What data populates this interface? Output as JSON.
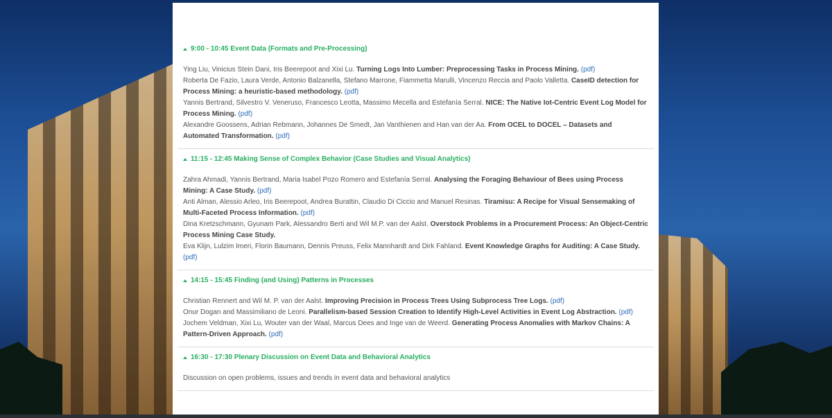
{
  "sessions": [
    {
      "title": "9:00 - 10:45 Event Data (Formats and Pre-Processing)",
      "papers": [
        {
          "authors": "Ying Liu, Vinicius Stein Dani, Iris Beerepoot and Xixi Lu.",
          "title": "Turning Logs Into Lumber: Preprocessing Tasks in Process Mining.",
          "link": "(pdf)"
        },
        {
          "authors": "Roberta De Fazio, Laura Verde, Antonio Balzanella, Stefano Marrone, Fiammetta Marulli, Vincenzo Reccia and Paolo Valletta.",
          "title": "CaseID detection for Process Mining: a heuristic-based methodology.",
          "link": "(pdf)"
        },
        {
          "authors": "Yannis Bertrand, Silvestro V. Veneruso, Francesco Leotta, Massimo Mecella and Estefanía Serral.",
          "title": "NICE: The Native Iot-Centric Event Log Model for Process Mining.",
          "link": "(pdf)"
        },
        {
          "authors": "Alexandre Goossens, Adrian Rebmann, Johannes De Smedt, Jan Vanthienen and Han van der Aa.",
          "title": "From OCEL to DOCEL – Datasets and Automated Transformation.",
          "link": "(pdf)"
        }
      ]
    },
    {
      "title": "11:15 - 12:45 Making Sense of Complex Behavior (Case Studies and Visual Analytics)",
      "papers": [
        {
          "authors": "Zahra Ahmadi, Yannis Bertrand, Maria Isabel Pozo Romero and Estefanía Serral.",
          "title": "Analysing the Foraging Behaviour of Bees using Process Mining: A Case Study.",
          "link": "(pdf)"
        },
        {
          "authors": "Anti Alman, Alessio Arleo, Iris Beerepoot, Andrea Burattin, Claudio Di Ciccio and Manuel Resinas.",
          "title": "Tiramisu: A Recipe for Visual Sensemaking of Multi-Faceted Process Information.",
          "link": "(pdf)"
        },
        {
          "authors": "Dina Kretzschmann, Gyunam Park, Alessandro Berti and Wil M.P. van der Aalst.",
          "title": "Overstock Problems in a Procurement Process: An Object-Centric Process Mining Case Study.",
          "link": ""
        },
        {
          "authors": "Eva Klijn, Lulzim Imeri, Florin Baumann, Dennis Preuss, Felix Mannhardt and Dirk Fahland.",
          "title": "Event Knowledge Graphs for Auditing: A Case Study.",
          "link": "(pdf)"
        }
      ]
    },
    {
      "title": "14:15 - 15:45 Finding (and Using) Patterns in Processes",
      "papers": [
        {
          "authors": "Christian Rennert and Wil M. P. van der Aalst.",
          "title": "Improving Precision in Process Trees Using Subprocess Tree Logs.",
          "link": "(pdf)"
        },
        {
          "authors": "Onur Dogan and Massimiliano de Leoni.",
          "title": "Parallelism-based Session Creation to Identify High-Level Activities in Event Log Abstraction.",
          "link": "(pdf)"
        },
        {
          "authors": "Jochem Veldman, Xixi Lu, Wouter van der Waal, Marcus Dees and Inge van de Weerd.",
          "title": " Generating Process Anomalies with Markov Chains: A Pattern-Driven Approach.",
          "link": "(pdf)"
        }
      ]
    },
    {
      "title": "16:30 - 17:30 Plenary Discussion on Event Data and Behavioral Analytics",
      "description": "Discussion on open problems, issues and trends in event data and behavioral analytics"
    }
  ],
  "colors": {
    "accent": "#27ae60",
    "link": "#2d6bb5"
  }
}
